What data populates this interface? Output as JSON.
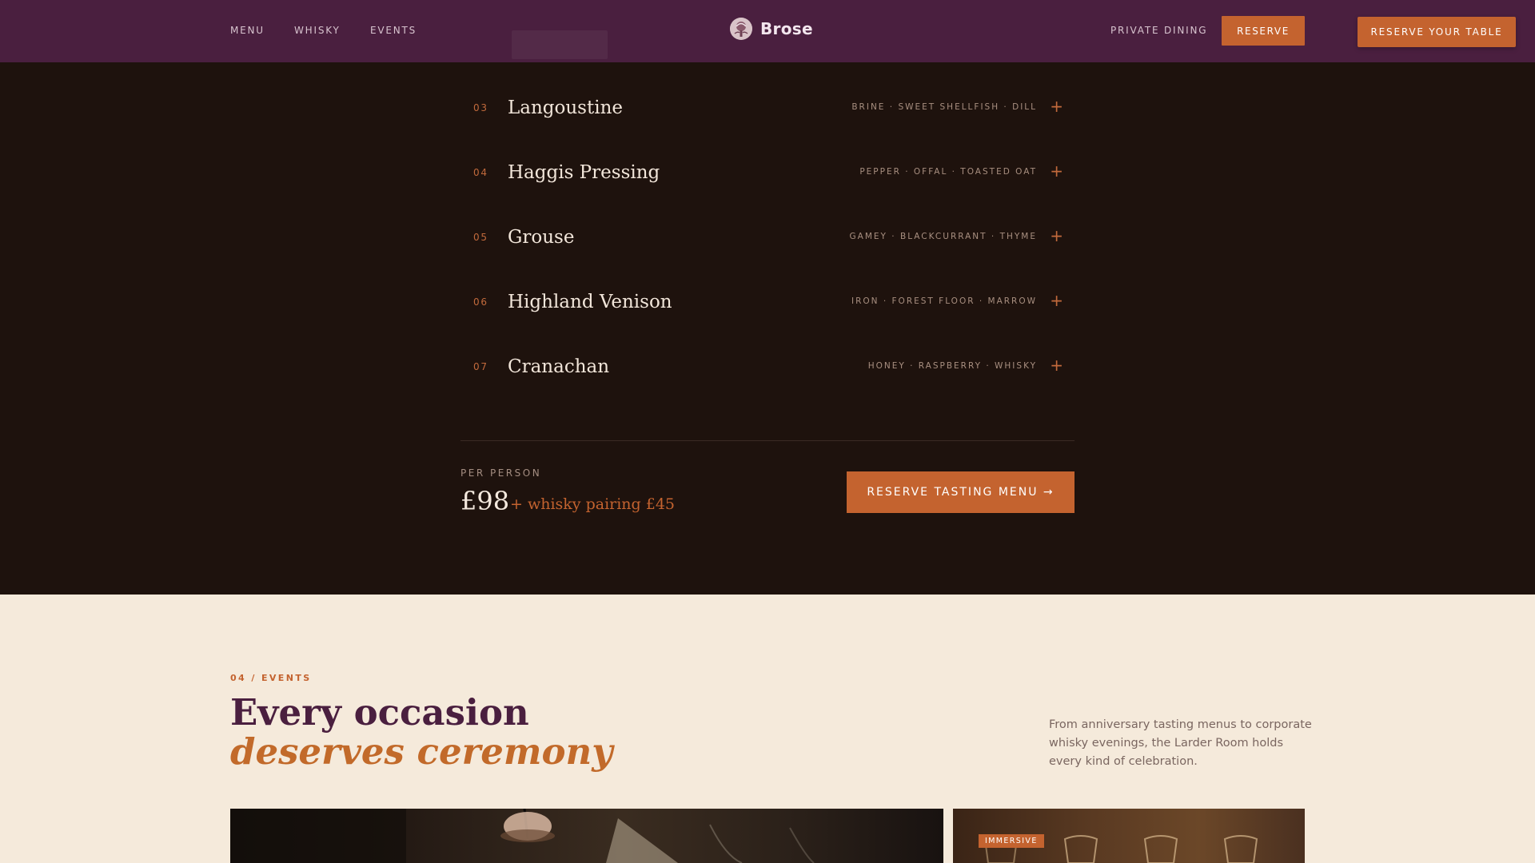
{
  "header": {
    "nav": [
      "MENU",
      "WHISKY",
      "EVENTS"
    ],
    "brand": "Brose",
    "private_dining": "PRIVATE DINING",
    "reserve": "RESERVE",
    "reserve_table": "RESERVE YOUR TABLE"
  },
  "tasting": {
    "courses": [
      {
        "num": "03",
        "name": "Langoustine",
        "notes": "BRINE · SWEET SHELLFISH · DILL"
      },
      {
        "num": "04",
        "name": "Haggis Pressing",
        "notes": "PEPPER · OFFAL · TOASTED OAT"
      },
      {
        "num": "05",
        "name": "Grouse",
        "notes": "GAMEY · BLACKCURRANT · THYME"
      },
      {
        "num": "06",
        "name": "Highland Venison",
        "notes": "IRON · FOREST FLOOR · MARROW"
      },
      {
        "num": "07",
        "name": "Cranachan",
        "notes": "HONEY · RASPBERRY · WHISKY"
      }
    ],
    "expand_symbol": "+",
    "per_person_label": "PER PERSON",
    "price": "£98",
    "pairing": "+ whisky pairing £45",
    "cta": "RESERVE TASTING MENU →"
  },
  "events": {
    "eyebrow": "04 / EVENTS",
    "title_line1": "Every occasion",
    "title_line2": "deserves ceremony",
    "description": "From anniversary tasting menus to corporate whisky evenings, the Larder Room holds every kind of celebration.",
    "card_badge": "IMMERSIVE"
  },
  "colors": {
    "header_bg": "#4a1f3f",
    "accent": "#c4632f",
    "dark_bg": "#1e120d",
    "cream_bg": "#f5eadb"
  }
}
